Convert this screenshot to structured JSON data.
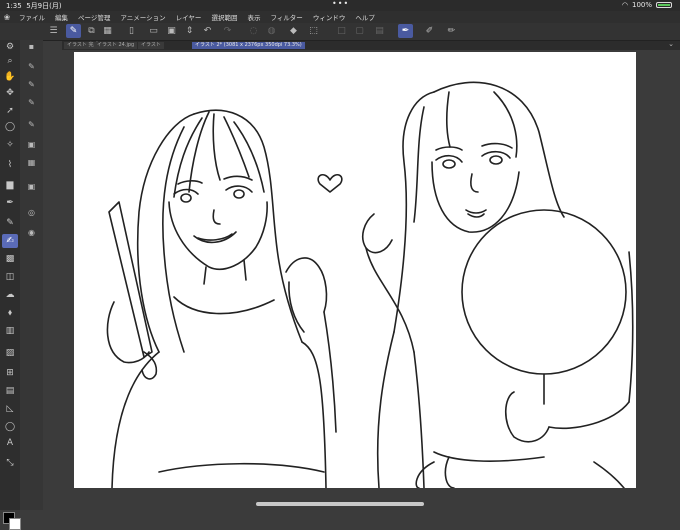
{
  "status": {
    "time": "1:35",
    "date": "5月9日(月)",
    "dots": "•••",
    "battery": "100%"
  },
  "menu": {
    "items": [
      "ファイル",
      "編集",
      "ページ管理",
      "アニメーション",
      "レイヤー",
      "選択範囲",
      "表示",
      "フィルター",
      "ウィンドウ",
      "ヘルプ"
    ]
  },
  "tabs": [
    {
      "label": "イラスト 完成3"
    },
    {
      "label": "イラスト 24.jpg"
    },
    {
      "label": "イラスト"
    },
    {
      "label": "イラスト 2* (3081 x 2376px 350dpi 73.3%)"
    }
  ],
  "colors": {
    "accent": "#4a5aa0",
    "background": "#3b3b3b",
    "canvas": "#ffffff"
  }
}
